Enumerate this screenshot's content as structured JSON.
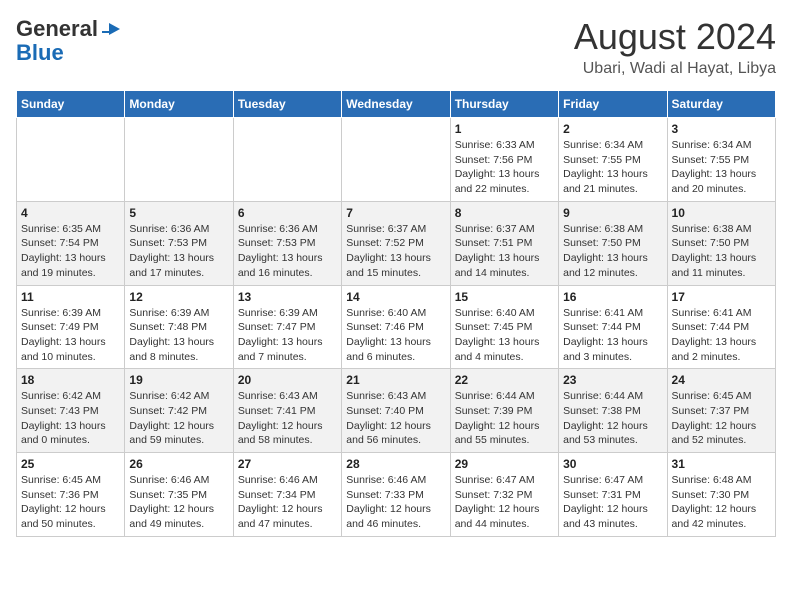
{
  "header": {
    "logo_line1": "General",
    "logo_line2": "Blue",
    "main_title": "August 2024",
    "sub_title": "Ubari, Wadi al Hayat, Libya"
  },
  "weekdays": [
    "Sunday",
    "Monday",
    "Tuesday",
    "Wednesday",
    "Thursday",
    "Friday",
    "Saturday"
  ],
  "weeks": [
    [
      {
        "day": "",
        "sunrise": "",
        "sunset": "",
        "daylight": ""
      },
      {
        "day": "",
        "sunrise": "",
        "sunset": "",
        "daylight": ""
      },
      {
        "day": "",
        "sunrise": "",
        "sunset": "",
        "daylight": ""
      },
      {
        "day": "",
        "sunrise": "",
        "sunset": "",
        "daylight": ""
      },
      {
        "day": "1",
        "sunrise": "Sunrise: 6:33 AM",
        "sunset": "Sunset: 7:56 PM",
        "daylight": "Daylight: 13 hours and 22 minutes."
      },
      {
        "day": "2",
        "sunrise": "Sunrise: 6:34 AM",
        "sunset": "Sunset: 7:55 PM",
        "daylight": "Daylight: 13 hours and 21 minutes."
      },
      {
        "day": "3",
        "sunrise": "Sunrise: 6:34 AM",
        "sunset": "Sunset: 7:55 PM",
        "daylight": "Daylight: 13 hours and 20 minutes."
      }
    ],
    [
      {
        "day": "4",
        "sunrise": "Sunrise: 6:35 AM",
        "sunset": "Sunset: 7:54 PM",
        "daylight": "Daylight: 13 hours and 19 minutes."
      },
      {
        "day": "5",
        "sunrise": "Sunrise: 6:36 AM",
        "sunset": "Sunset: 7:53 PM",
        "daylight": "Daylight: 13 hours and 17 minutes."
      },
      {
        "day": "6",
        "sunrise": "Sunrise: 6:36 AM",
        "sunset": "Sunset: 7:53 PM",
        "daylight": "Daylight: 13 hours and 16 minutes."
      },
      {
        "day": "7",
        "sunrise": "Sunrise: 6:37 AM",
        "sunset": "Sunset: 7:52 PM",
        "daylight": "Daylight: 13 hours and 15 minutes."
      },
      {
        "day": "8",
        "sunrise": "Sunrise: 6:37 AM",
        "sunset": "Sunset: 7:51 PM",
        "daylight": "Daylight: 13 hours and 14 minutes."
      },
      {
        "day": "9",
        "sunrise": "Sunrise: 6:38 AM",
        "sunset": "Sunset: 7:50 PM",
        "daylight": "Daylight: 13 hours and 12 minutes."
      },
      {
        "day": "10",
        "sunrise": "Sunrise: 6:38 AM",
        "sunset": "Sunset: 7:50 PM",
        "daylight": "Daylight: 13 hours and 11 minutes."
      }
    ],
    [
      {
        "day": "11",
        "sunrise": "Sunrise: 6:39 AM",
        "sunset": "Sunset: 7:49 PM",
        "daylight": "Daylight: 13 hours and 10 minutes."
      },
      {
        "day": "12",
        "sunrise": "Sunrise: 6:39 AM",
        "sunset": "Sunset: 7:48 PM",
        "daylight": "Daylight: 13 hours and 8 minutes."
      },
      {
        "day": "13",
        "sunrise": "Sunrise: 6:39 AM",
        "sunset": "Sunset: 7:47 PM",
        "daylight": "Daylight: 13 hours and 7 minutes."
      },
      {
        "day": "14",
        "sunrise": "Sunrise: 6:40 AM",
        "sunset": "Sunset: 7:46 PM",
        "daylight": "Daylight: 13 hours and 6 minutes."
      },
      {
        "day": "15",
        "sunrise": "Sunrise: 6:40 AM",
        "sunset": "Sunset: 7:45 PM",
        "daylight": "Daylight: 13 hours and 4 minutes."
      },
      {
        "day": "16",
        "sunrise": "Sunrise: 6:41 AM",
        "sunset": "Sunset: 7:44 PM",
        "daylight": "Daylight: 13 hours and 3 minutes."
      },
      {
        "day": "17",
        "sunrise": "Sunrise: 6:41 AM",
        "sunset": "Sunset: 7:44 PM",
        "daylight": "Daylight: 13 hours and 2 minutes."
      }
    ],
    [
      {
        "day": "18",
        "sunrise": "Sunrise: 6:42 AM",
        "sunset": "Sunset: 7:43 PM",
        "daylight": "Daylight: 13 hours and 0 minutes."
      },
      {
        "day": "19",
        "sunrise": "Sunrise: 6:42 AM",
        "sunset": "Sunset: 7:42 PM",
        "daylight": "Daylight: 12 hours and 59 minutes."
      },
      {
        "day": "20",
        "sunrise": "Sunrise: 6:43 AM",
        "sunset": "Sunset: 7:41 PM",
        "daylight": "Daylight: 12 hours and 58 minutes."
      },
      {
        "day": "21",
        "sunrise": "Sunrise: 6:43 AM",
        "sunset": "Sunset: 7:40 PM",
        "daylight": "Daylight: 12 hours and 56 minutes."
      },
      {
        "day": "22",
        "sunrise": "Sunrise: 6:44 AM",
        "sunset": "Sunset: 7:39 PM",
        "daylight": "Daylight: 12 hours and 55 minutes."
      },
      {
        "day": "23",
        "sunrise": "Sunrise: 6:44 AM",
        "sunset": "Sunset: 7:38 PM",
        "daylight": "Daylight: 12 hours and 53 minutes."
      },
      {
        "day": "24",
        "sunrise": "Sunrise: 6:45 AM",
        "sunset": "Sunset: 7:37 PM",
        "daylight": "Daylight: 12 hours and 52 minutes."
      }
    ],
    [
      {
        "day": "25",
        "sunrise": "Sunrise: 6:45 AM",
        "sunset": "Sunset: 7:36 PM",
        "daylight": "Daylight: 12 hours and 50 minutes."
      },
      {
        "day": "26",
        "sunrise": "Sunrise: 6:46 AM",
        "sunset": "Sunset: 7:35 PM",
        "daylight": "Daylight: 12 hours and 49 minutes."
      },
      {
        "day": "27",
        "sunrise": "Sunrise: 6:46 AM",
        "sunset": "Sunset: 7:34 PM",
        "daylight": "Daylight: 12 hours and 47 minutes."
      },
      {
        "day": "28",
        "sunrise": "Sunrise: 6:46 AM",
        "sunset": "Sunset: 7:33 PM",
        "daylight": "Daylight: 12 hours and 46 minutes."
      },
      {
        "day": "29",
        "sunrise": "Sunrise: 6:47 AM",
        "sunset": "Sunset: 7:32 PM",
        "daylight": "Daylight: 12 hours and 44 minutes."
      },
      {
        "day": "30",
        "sunrise": "Sunrise: 6:47 AM",
        "sunset": "Sunset: 7:31 PM",
        "daylight": "Daylight: 12 hours and 43 minutes."
      },
      {
        "day": "31",
        "sunrise": "Sunrise: 6:48 AM",
        "sunset": "Sunset: 7:30 PM",
        "daylight": "Daylight: 12 hours and 42 minutes."
      }
    ]
  ]
}
